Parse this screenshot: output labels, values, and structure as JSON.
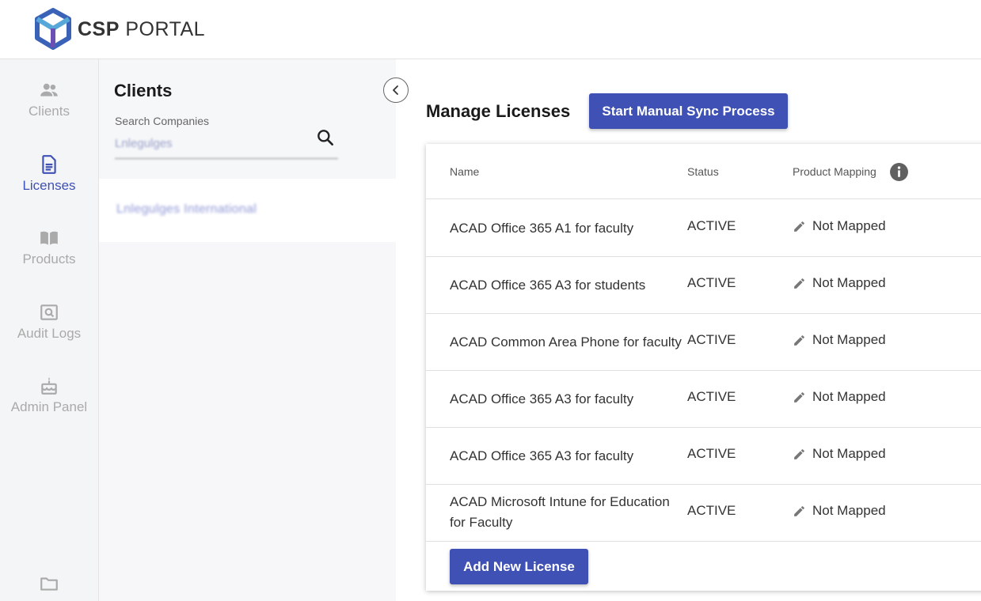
{
  "brand": {
    "strong": "CSP",
    "light": "PORTAL"
  },
  "nav": {
    "items": [
      {
        "label": "Clients",
        "icon": "people-icon",
        "active": false
      },
      {
        "label": "Licenses",
        "icon": "document-icon",
        "active": true
      },
      {
        "label": "Products",
        "icon": "book-icon",
        "active": false
      },
      {
        "label": "Audit Logs",
        "icon": "audit-icon",
        "active": false
      },
      {
        "label": "Admin Panel",
        "icon": "cake-icon",
        "active": false
      }
    ]
  },
  "clients": {
    "title": "Clients",
    "search_label": "Search Companies",
    "search_value": "Lnlegulges",
    "selected_client": "Lnlegulges International"
  },
  "main": {
    "title": "Manage Licenses",
    "sync_button": "Start Manual Sync Process",
    "add_button": "Add New License",
    "columns": {
      "name": "Name",
      "status": "Status",
      "mapping": "Product Mapping"
    },
    "rows": [
      {
        "name": "ACAD Office 365 A1 for faculty",
        "status": "ACTIVE",
        "mapping": "Not Mapped"
      },
      {
        "name": "ACAD Office 365 A3 for students",
        "status": "ACTIVE",
        "mapping": "Not Mapped"
      },
      {
        "name": "ACAD Common Area Phone for faculty",
        "status": "ACTIVE",
        "mapping": "Not Mapped"
      },
      {
        "name": "ACAD Office 365 A3 for faculty",
        "status": "ACTIVE",
        "mapping": "Not Mapped"
      },
      {
        "name": "ACAD Office 365 A3 for faculty",
        "status": "ACTIVE",
        "mapping": "Not Mapped"
      },
      {
        "name": "ACAD Microsoft Intune for Education for Faculty",
        "status": "ACTIVE",
        "mapping": "Not Mapped"
      }
    ]
  },
  "colors": {
    "accent": "#3f51b5",
    "nav_inactive": "#aaaaaa"
  }
}
